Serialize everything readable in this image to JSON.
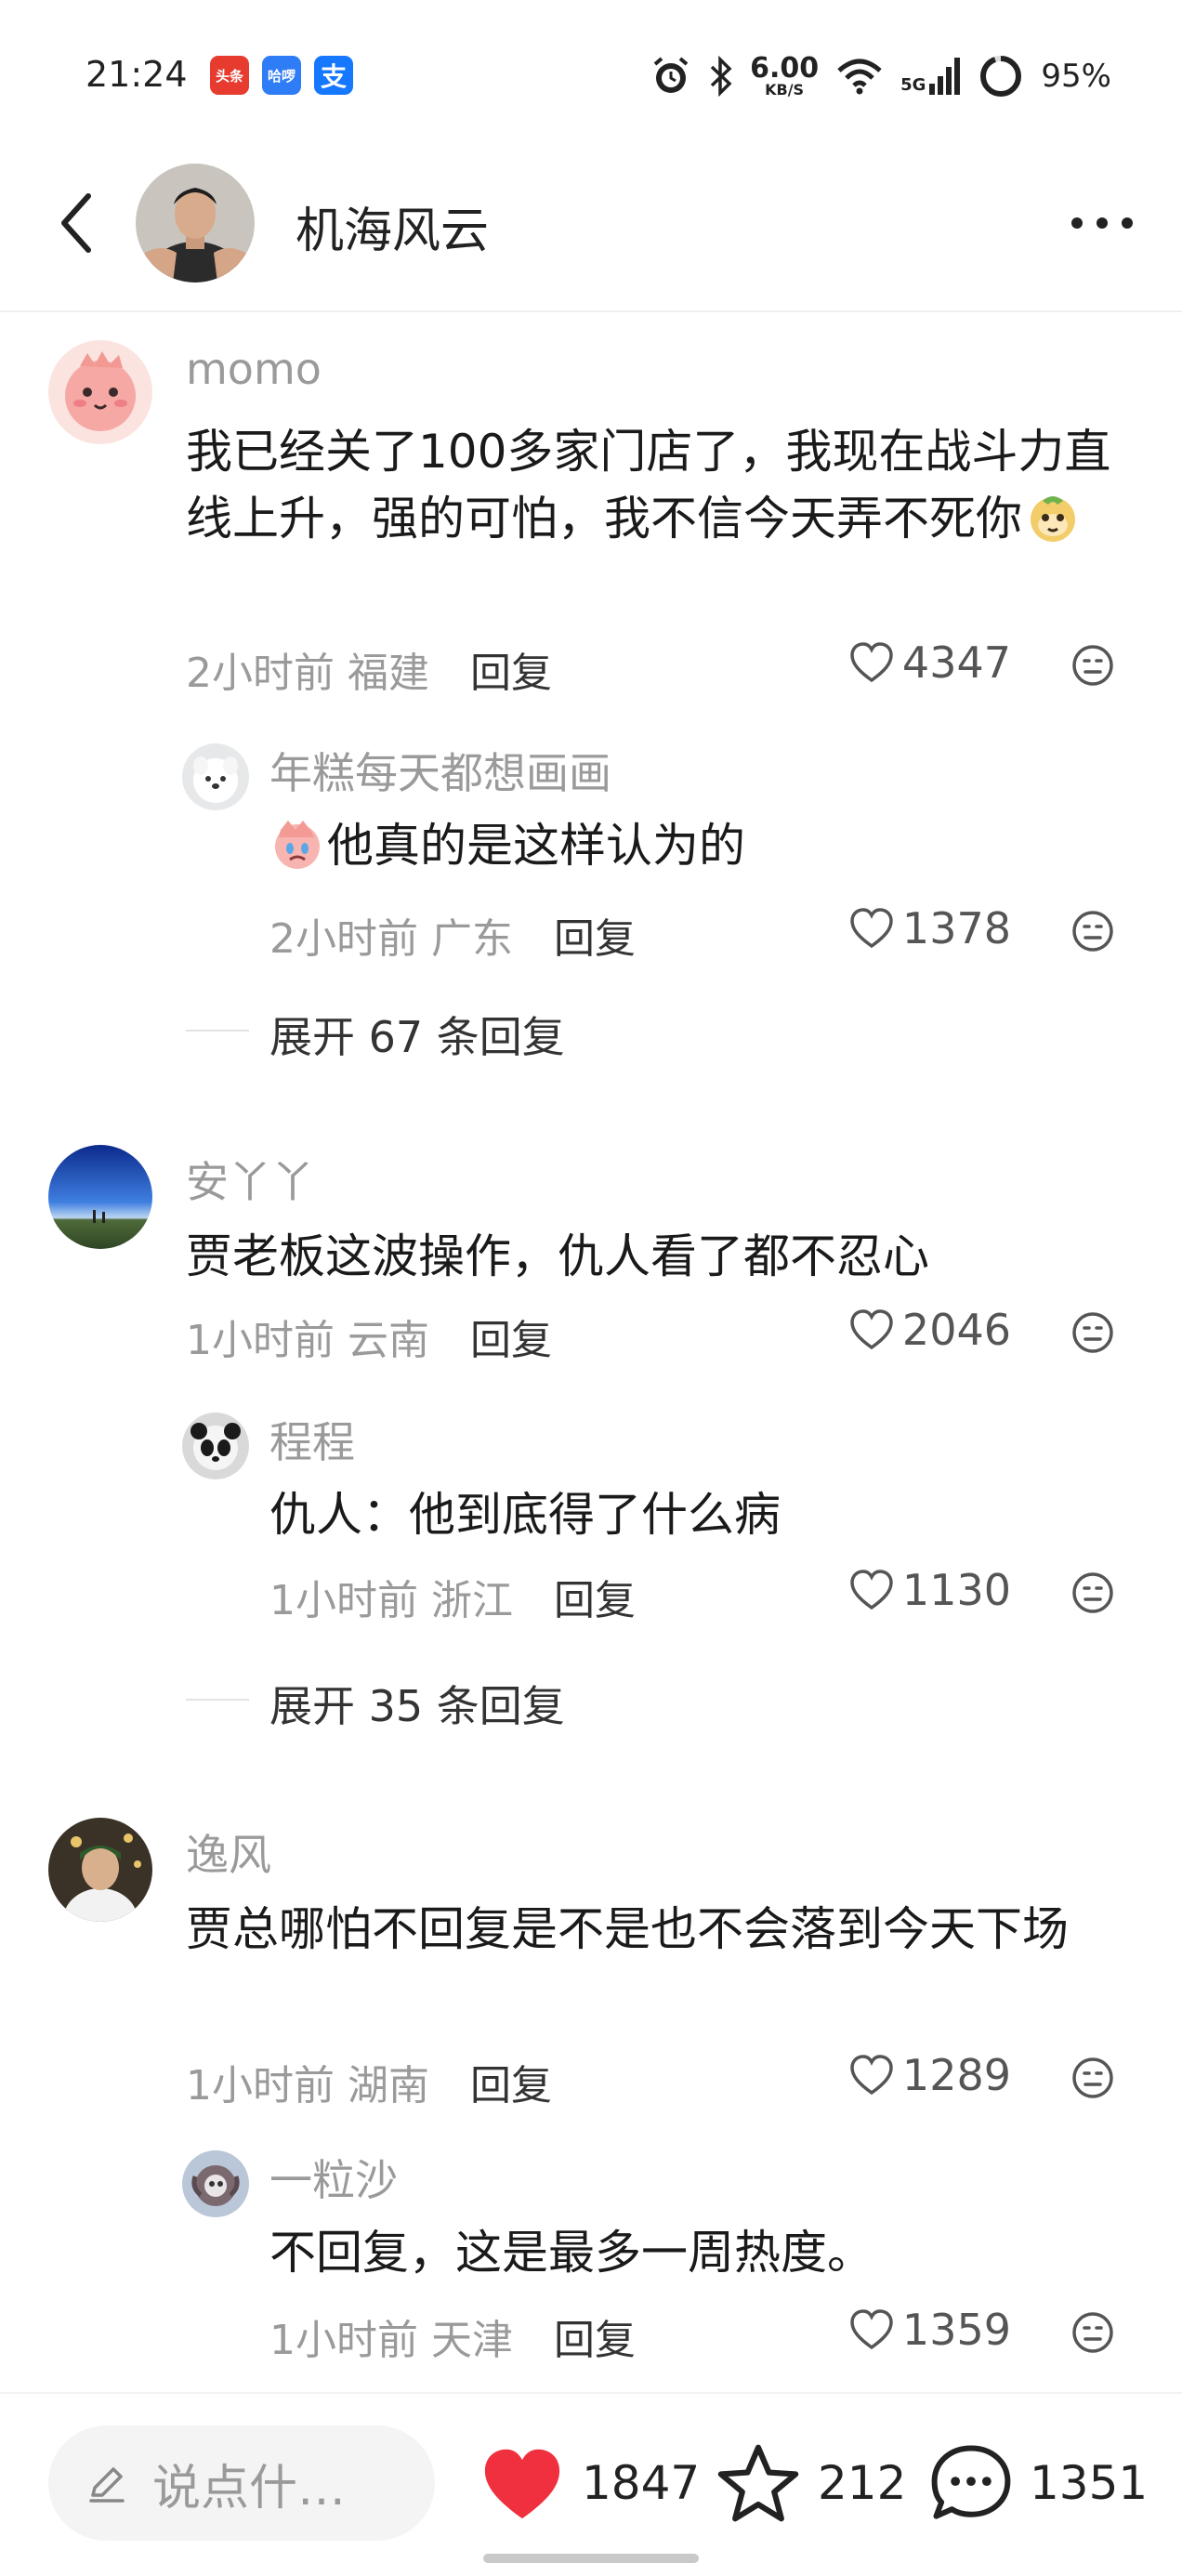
{
  "status_bar": {
    "time": "21:24",
    "apps": [
      "头条",
      "哈啰",
      "支"
    ],
    "speed_value": "6.00",
    "speed_unit": "KB/S",
    "network": "5G",
    "battery": "95%"
  },
  "header": {
    "title": "机海风云"
  },
  "comments": [
    {
      "name": "momo",
      "text": "我已经关了100多家门店了，我现在战斗力直线上升，强的可怕，我不信今天弄不死你",
      "time": "2小时前",
      "location": "福建",
      "reply_label": "回复",
      "likes": "4347",
      "replies": [
        {
          "name": "年糕每天都想画画",
          "text": "他真的是这样认为的",
          "time": "2小时前",
          "location": "广东",
          "reply_label": "回复",
          "likes": "1378"
        }
      ],
      "expand": "展开 67 条回复"
    },
    {
      "name": "安丫丫",
      "text": "贾老板这波操作，仇人看了都不忍心",
      "time": "1小时前",
      "location": "云南",
      "reply_label": "回复",
      "likes": "2046",
      "replies": [
        {
          "name": "程程",
          "text": "仇人：他到底得了什么病",
          "time": "1小时前",
          "location": "浙江",
          "reply_label": "回复",
          "likes": "1130"
        }
      ],
      "expand": "展开 35 条回复"
    },
    {
      "name": "逸风",
      "text": "贾总哪怕不回复是不是也不会落到今天下场",
      "time": "1小时前",
      "location": "湖南",
      "reply_label": "回复",
      "likes": "1289",
      "replies": [
        {
          "name": "一粒沙",
          "text": "不回复，这是最多一周热度。",
          "time": "1小时前",
          "location": "天津",
          "reply_label": "回复",
          "likes": "1359"
        }
      ]
    }
  ],
  "bottom_bar": {
    "input_placeholder": "说点什…",
    "like_count": "1847",
    "star_count": "212",
    "comment_count": "1351"
  },
  "colors": {
    "like_red": "#f0303f",
    "muted_text": "#9a9a9a"
  }
}
